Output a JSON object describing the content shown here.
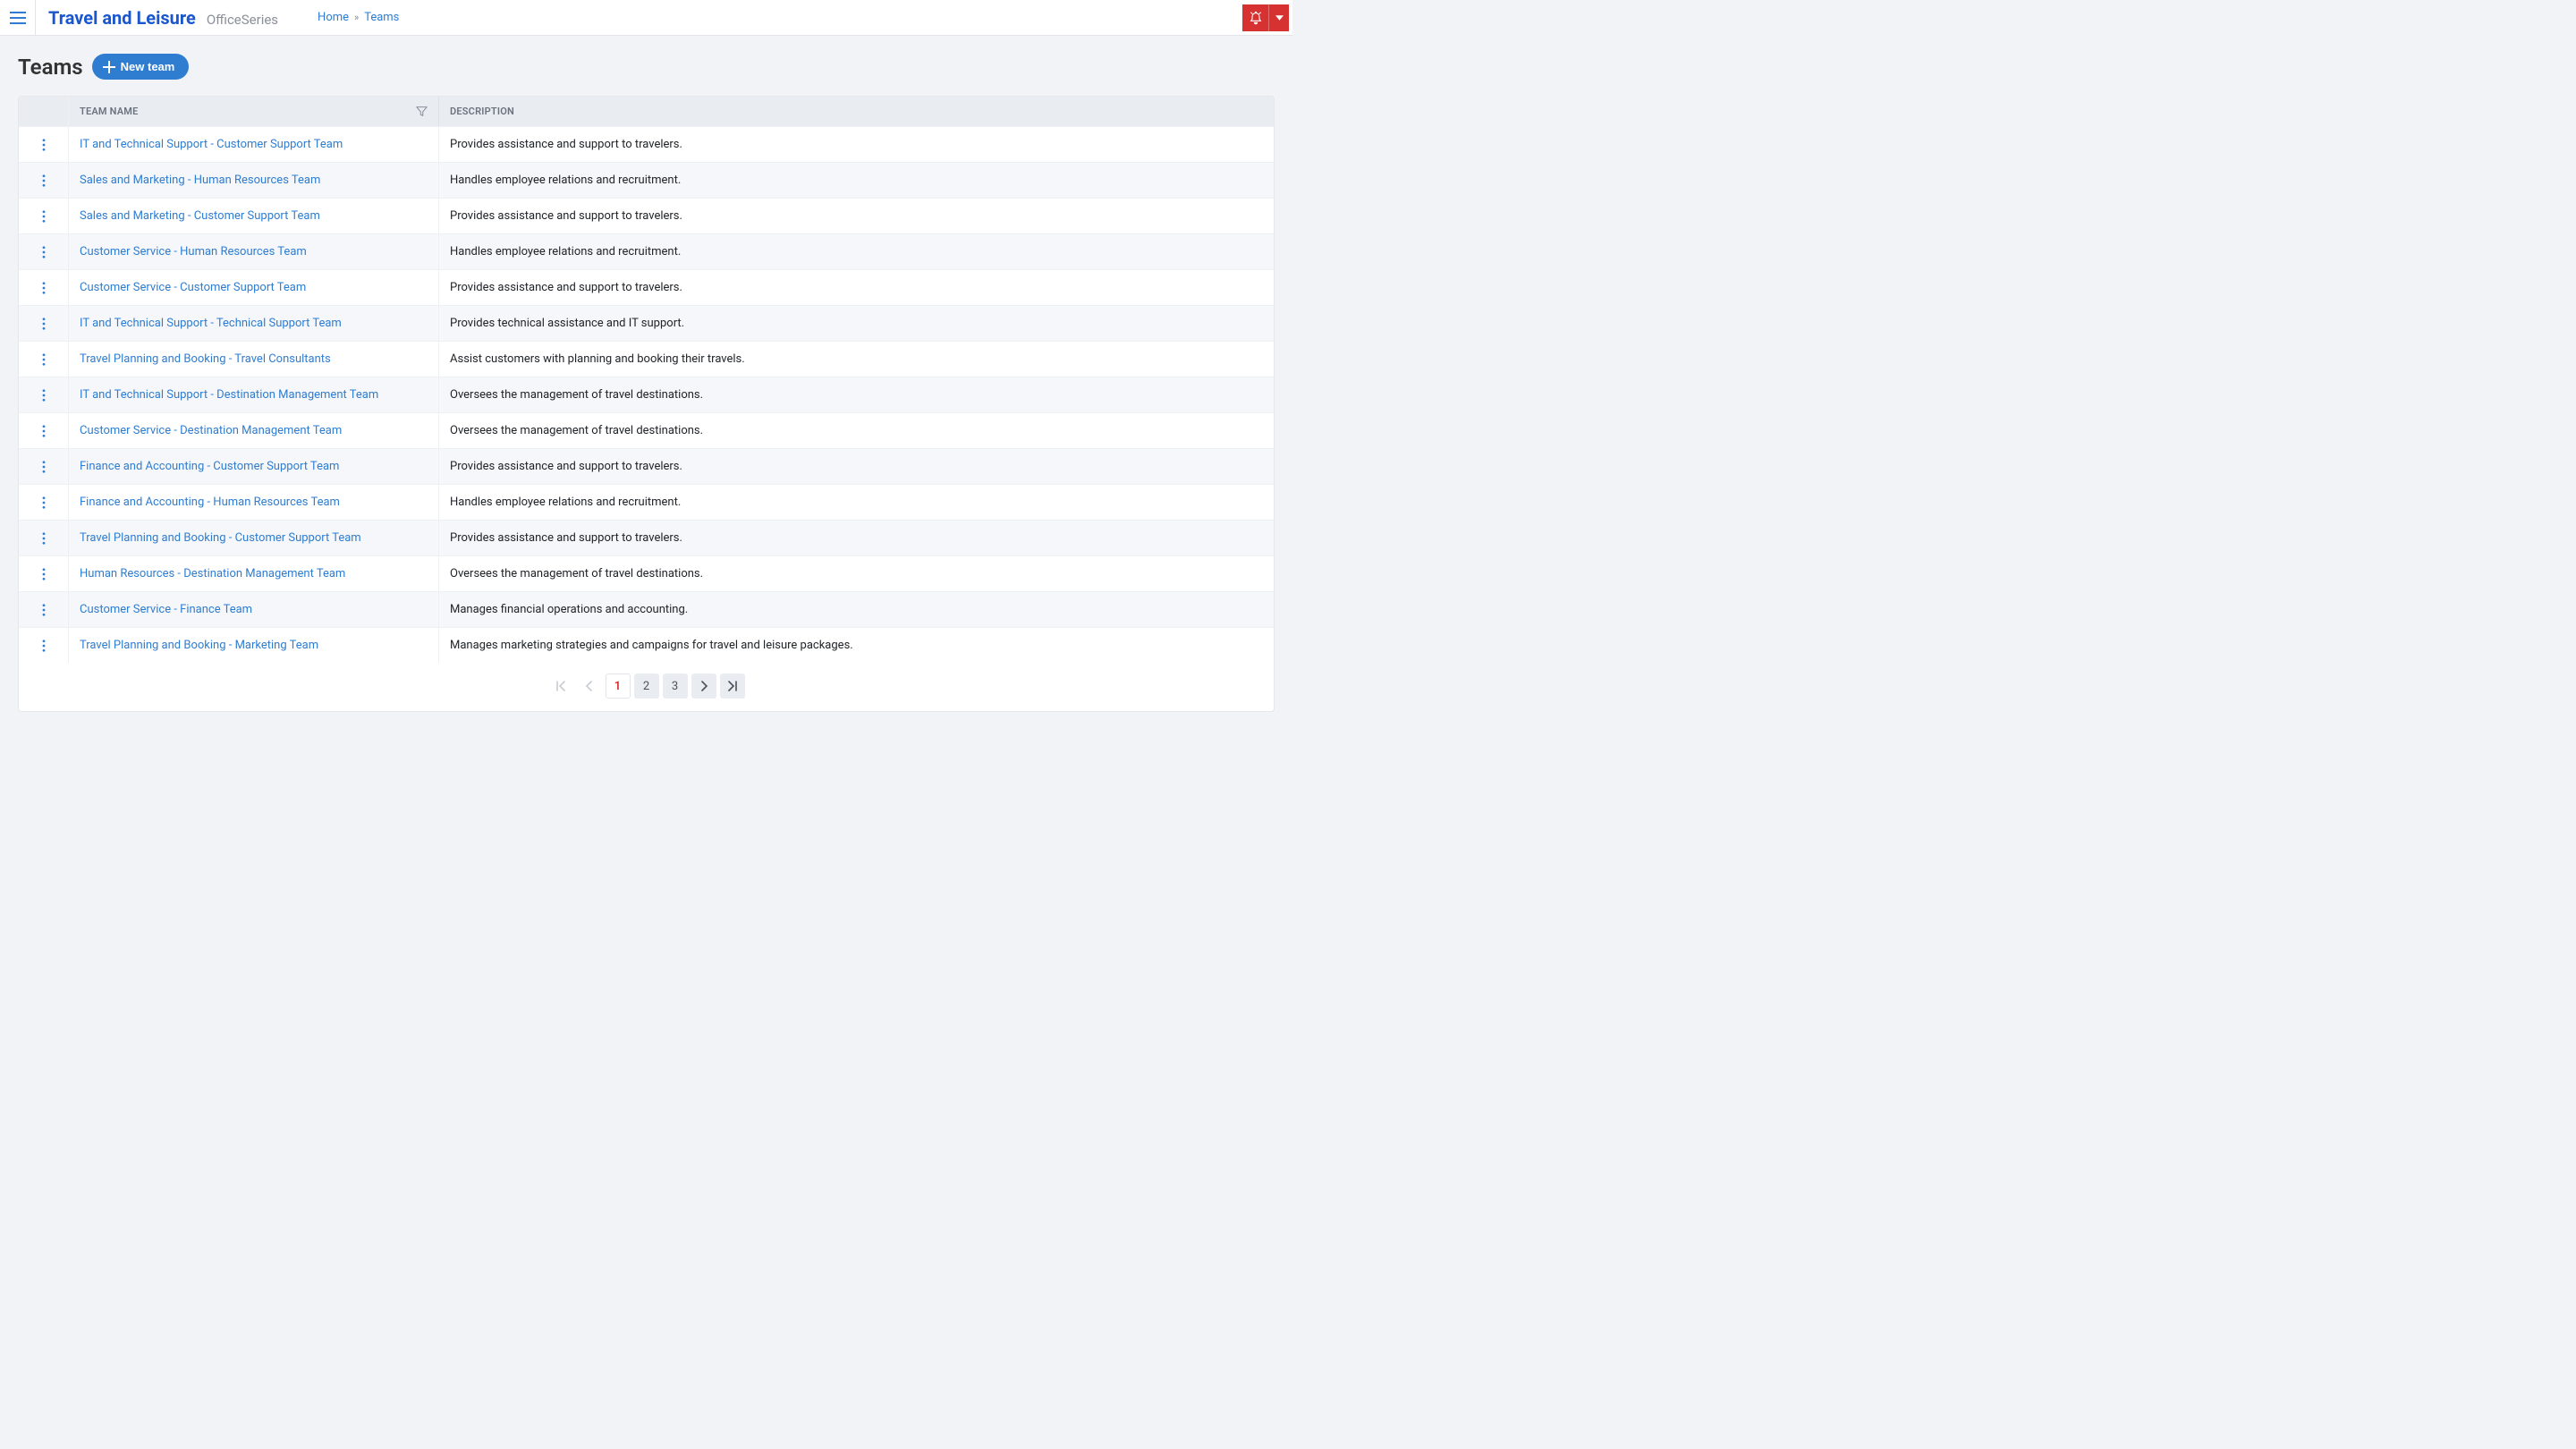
{
  "brand": {
    "primary": "Travel and Leisure",
    "secondary": "OfficeSeries"
  },
  "breadcrumb": {
    "home": "Home",
    "current": "Teams"
  },
  "page": {
    "title": "Teams",
    "new_button": "New team"
  },
  "table": {
    "headers": {
      "name": "Team Name",
      "description": "Description"
    },
    "rows": [
      {
        "name": "IT and Technical Support - Customer Support Team",
        "description": "Provides assistance and support to travelers."
      },
      {
        "name": "Sales and Marketing - Human Resources Team",
        "description": "Handles employee relations and recruitment."
      },
      {
        "name": "Sales and Marketing - Customer Support Team",
        "description": "Provides assistance and support to travelers."
      },
      {
        "name": "Customer Service - Human Resources Team",
        "description": "Handles employee relations and recruitment."
      },
      {
        "name": "Customer Service - Customer Support Team",
        "description": "Provides assistance and support to travelers."
      },
      {
        "name": "IT and Technical Support - Technical Support Team",
        "description": "Provides technical assistance and IT support."
      },
      {
        "name": "Travel Planning and Booking - Travel Consultants",
        "description": "Assist customers with planning and booking their travels."
      },
      {
        "name": "IT and Technical Support - Destination Management Team",
        "description": "Oversees the management of travel destinations."
      },
      {
        "name": "Customer Service - Destination Management Team",
        "description": "Oversees the management of travel destinations."
      },
      {
        "name": "Finance and Accounting - Customer Support Team",
        "description": "Provides assistance and support to travelers."
      },
      {
        "name": "Finance and Accounting - Human Resources Team",
        "description": "Handles employee relations and recruitment."
      },
      {
        "name": "Travel Planning and Booking - Customer Support Team",
        "description": "Provides assistance and support to travelers."
      },
      {
        "name": "Human Resources - Destination Management Team",
        "description": "Oversees the management of travel destinations."
      },
      {
        "name": "Customer Service - Finance Team",
        "description": "Manages financial operations and accounting."
      },
      {
        "name": "Travel Planning and Booking - Marketing Team",
        "description": "Manages marketing strategies and campaigns for travel and leisure packages."
      }
    ]
  },
  "pager": {
    "pages": [
      "1",
      "2",
      "3"
    ],
    "current": "1"
  }
}
